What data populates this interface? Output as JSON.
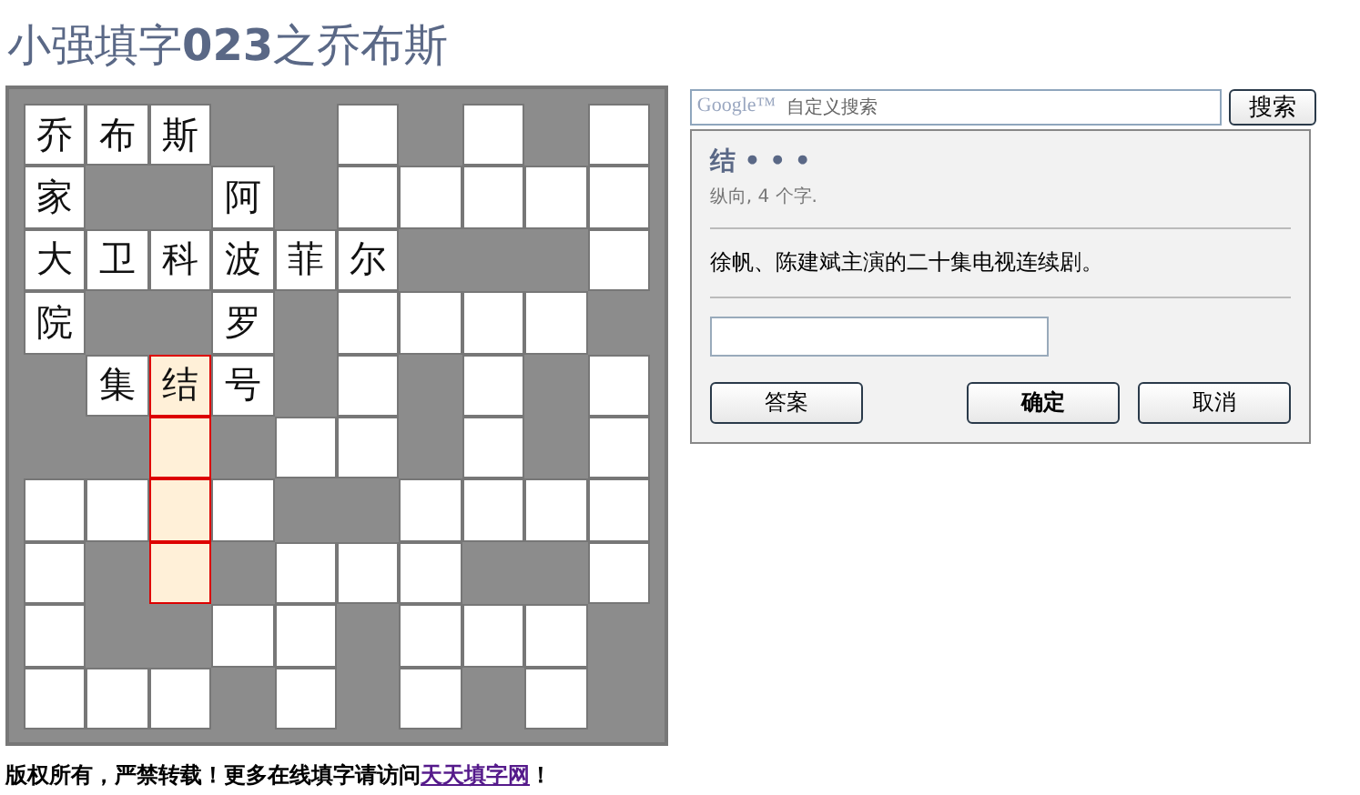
{
  "title": "小强填字**023**之乔布斯",
  "grid": [
    {
      "cells": [
        {
          "kind": "open",
          "text": "乔",
          "selected": false
        },
        {
          "kind": "open",
          "text": "布",
          "selected": false
        },
        {
          "kind": "open",
          "text": "斯",
          "selected": false
        },
        {
          "kind": "block"
        },
        {
          "kind": "block"
        },
        {
          "kind": "open",
          "selected": false
        },
        {
          "kind": "block"
        },
        {
          "kind": "open",
          "selected": false
        },
        {
          "kind": "block"
        },
        {
          "kind": "open",
          "selected": false
        }
      ]
    },
    {
      "cells": [
        {
          "kind": "open",
          "text": "家",
          "selected": false
        },
        {
          "kind": "block"
        },
        {
          "kind": "block"
        },
        {
          "kind": "open",
          "text": "阿",
          "selected": false
        },
        {
          "kind": "block"
        },
        {
          "kind": "open",
          "selected": false
        },
        {
          "kind": "open",
          "selected": false
        },
        {
          "kind": "open",
          "selected": false
        },
        {
          "kind": "open",
          "selected": false
        },
        {
          "kind": "open",
          "selected": false
        }
      ]
    },
    {
      "cells": [
        {
          "kind": "open",
          "text": "大",
          "selected": false
        },
        {
          "kind": "open",
          "text": "卫",
          "selected": false
        },
        {
          "kind": "open",
          "text": "科",
          "selected": false
        },
        {
          "kind": "open",
          "text": "波",
          "selected": false
        },
        {
          "kind": "open",
          "text": "菲",
          "selected": false
        },
        {
          "kind": "open",
          "text": "尔",
          "selected": false
        },
        {
          "kind": "block"
        },
        {
          "kind": "block"
        },
        {
          "kind": "block"
        },
        {
          "kind": "open",
          "selected": false
        }
      ]
    },
    {
      "cells": [
        {
          "kind": "open",
          "text": "院",
          "selected": false
        },
        {
          "kind": "block"
        },
        {
          "kind": "block"
        },
        {
          "kind": "open",
          "text": "罗",
          "selected": false
        },
        {
          "kind": "block"
        },
        {
          "kind": "open",
          "selected": false
        },
        {
          "kind": "open",
          "selected": false
        },
        {
          "kind": "open",
          "selected": false
        },
        {
          "kind": "open",
          "selected": false
        },
        {
          "kind": "block"
        }
      ]
    },
    {
      "cells": [
        {
          "kind": "block"
        },
        {
          "kind": "open",
          "text": "集",
          "selected": false
        },
        {
          "kind": "open",
          "text": "结",
          "selected": true
        },
        {
          "kind": "open",
          "text": "号",
          "selected": false
        },
        {
          "kind": "block"
        },
        {
          "kind": "open",
          "selected": false
        },
        {
          "kind": "block"
        },
        {
          "kind": "open",
          "selected": false
        },
        {
          "kind": "block"
        },
        {
          "kind": "open",
          "selected": false
        }
      ]
    },
    {
      "cells": [
        {
          "kind": "block"
        },
        {
          "kind": "block"
        },
        {
          "kind": "open",
          "selected": true
        },
        {
          "kind": "block"
        },
        {
          "kind": "open",
          "selected": false
        },
        {
          "kind": "open",
          "selected": false
        },
        {
          "kind": "block"
        },
        {
          "kind": "open",
          "selected": false
        },
        {
          "kind": "block"
        },
        {
          "kind": "open",
          "selected": false
        }
      ]
    },
    {
      "cells": [
        {
          "kind": "open",
          "selected": false
        },
        {
          "kind": "open",
          "selected": false
        },
        {
          "kind": "open",
          "selected": true
        },
        {
          "kind": "open",
          "selected": false
        },
        {
          "kind": "block"
        },
        {
          "kind": "block"
        },
        {
          "kind": "open",
          "selected": false
        },
        {
          "kind": "open",
          "selected": false
        },
        {
          "kind": "open",
          "selected": false
        },
        {
          "kind": "open",
          "selected": false
        }
      ]
    },
    {
      "cells": [
        {
          "kind": "open",
          "selected": false
        },
        {
          "kind": "block"
        },
        {
          "kind": "open",
          "selected": true
        },
        {
          "kind": "block"
        },
        {
          "kind": "open",
          "selected": false
        },
        {
          "kind": "open",
          "selected": false
        },
        {
          "kind": "open",
          "selected": false
        },
        {
          "kind": "block"
        },
        {
          "kind": "block"
        },
        {
          "kind": "open",
          "selected": false
        }
      ]
    },
    {
      "cells": [
        {
          "kind": "open",
          "selected": false
        },
        {
          "kind": "block"
        },
        {
          "kind": "block"
        },
        {
          "kind": "open",
          "selected": false
        },
        {
          "kind": "open",
          "selected": false
        },
        {
          "kind": "block"
        },
        {
          "kind": "open",
          "selected": false
        },
        {
          "kind": "open",
          "selected": false
        },
        {
          "kind": "open",
          "selected": false
        },
        {
          "kind": "block"
        }
      ]
    },
    {
      "cells": [
        {
          "kind": "open",
          "selected": false
        },
        {
          "kind": "open",
          "selected": false
        },
        {
          "kind": "open",
          "selected": false
        },
        {
          "kind": "block"
        },
        {
          "kind": "open",
          "selected": false
        },
        {
          "kind": "block"
        },
        {
          "kind": "open",
          "selected": false
        },
        {
          "kind": "block"
        },
        {
          "kind": "open",
          "selected": false
        },
        {
          "kind": "block"
        }
      ]
    }
  ],
  "search": {
    "logo": "Google™",
    "placeholder": "自定义搜索",
    "button": "搜索"
  },
  "clue": {
    "pattern": "结 • • •",
    "direction": "纵向, 4 个字.",
    "text": "徐帆、陈建斌主演的二十集电视连续剧。"
  },
  "buttons": [
    {
      "label": "答案",
      "primary": false
    },
    {
      "label": "确定",
      "primary": true
    },
    {
      "label": "取消",
      "primary": false
    }
  ],
  "footer": {
    "text": "版权所有，严禁转载！更多在线填字请访问",
    "link": "天天填字网",
    "end": "！"
  }
}
